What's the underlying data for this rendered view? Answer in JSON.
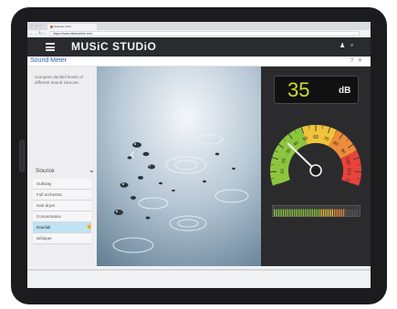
{
  "browser": {
    "tab_title": "Pearson eText",
    "url": "https://www.etextonline.com",
    "window_controls": "● ● ●",
    "back_glyph": "←",
    "forward_glyph": "→",
    "reload_glyph": "↻",
    "home_glyph": "⌂",
    "star_glyph": "☆"
  },
  "app": {
    "brand": "MUSiC STUDiO",
    "user_glyph": "♟",
    "search_glyph": "⌕"
  },
  "window": {
    "title": "Sound Meter",
    "help_glyph": "?",
    "close_glyph": "✕"
  },
  "sidebar": {
    "description": "Compare decibel levels of different sound sources.",
    "source_label": "Source",
    "chevron_glyph": "⌄",
    "items": [
      {
        "label": "Subway"
      },
      {
        "label": "Full orchestra"
      },
      {
        "label": "Hair dryer"
      },
      {
        "label": "Conversation"
      },
      {
        "label": "Rainfall"
      },
      {
        "label": "Whisper"
      }
    ],
    "selected_item": "Rainfall",
    "cursor_glyph": "☝"
  },
  "stage": {
    "prev_glyph": "‹",
    "next_glyph": "›",
    "subject": "Rain drops on water surface"
  },
  "meter": {
    "value": "35",
    "unit": "dB",
    "gauge_ticks": [
      "10",
      "20",
      "30",
      "40",
      "50",
      "60",
      "70",
      "80",
      "90",
      "100",
      "110",
      "120"
    ],
    "gauge_value": 35,
    "gauge_min": 0,
    "gauge_max": 120,
    "zone_colors": {
      "low": "#8cc63e",
      "mid": "#f0c33a",
      "high_mid": "#ef8c3b",
      "high": "#e8433a"
    },
    "level_fraction": 0.85
  },
  "colors": {
    "app_bar": "#2a2b2e",
    "title_link": "#2f5fa6",
    "selected_row": "#bfe3f2",
    "readout_digits": "#c9dd2a"
  }
}
